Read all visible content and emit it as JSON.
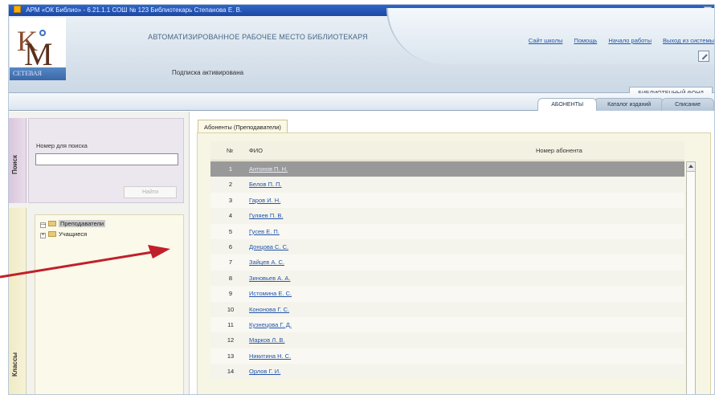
{
  "window": {
    "title": "АРМ «ОК Библио» - 6.21.1.1 СОШ № 123 Библиотекарь Степанова Е. В."
  },
  "logo": {
    "bar_text": "CЕТЕВАЯ"
  },
  "header": {
    "title": "АВТОМАТИЗИРОВАННОЕ РАБОЧЕЕ МЕСТО БИБЛИОТЕКАРЯ",
    "status": "Подписка активирована",
    "links": [
      "Сайт школы",
      "Помощь",
      "Начало работы",
      "Выход из системы"
    ],
    "section_tab": "БИБЛИОТЕЧНЫЙ ФОНД"
  },
  "tabs": [
    {
      "label": "АБОНЕНТЫ",
      "active": true
    },
    {
      "label": "Каталог изданий",
      "active": false
    },
    {
      "label": "Списание",
      "active": false
    }
  ],
  "sidebar": {
    "search_label": "Поиск",
    "catalog_label": "Классы",
    "search_field_label": "Номер для поиска",
    "search_value": "",
    "find_button": "Найти",
    "tree": [
      {
        "toggle": "—",
        "label": "Преподаватели",
        "selected": true
      },
      {
        "toggle": "+",
        "label": "Учащиеся",
        "selected": false
      }
    ]
  },
  "content": {
    "tab_label": "Абоненты (Преподаватели)",
    "columns": {
      "num": "№",
      "fio": "ФИО",
      "card": "Номер абонента"
    },
    "rows": [
      {
        "num": "1",
        "name": "Антонов П. Н.",
        "selected": true
      },
      {
        "num": "2",
        "name": "Белов П. П.",
        "selected": false
      },
      {
        "num": "3",
        "name": "Гаров И. Н.",
        "selected": false
      },
      {
        "num": "4",
        "name": "Гуляев П. В.",
        "selected": false
      },
      {
        "num": "5",
        "name": "Гусев Е. П.",
        "selected": false
      },
      {
        "num": "6",
        "name": "Донцова С. С.",
        "selected": false
      },
      {
        "num": "7",
        "name": "Зайцев А. С.",
        "selected": false
      },
      {
        "num": "8",
        "name": "Зиновьев А. А.",
        "selected": false
      },
      {
        "num": "9",
        "name": "Истомина Е. С.",
        "selected": false
      },
      {
        "num": "10",
        "name": "Кононова Г. С.",
        "selected": false
      },
      {
        "num": "11",
        "name": "Кузнецова Г. Д.",
        "selected": false
      },
      {
        "num": "12",
        "name": "Марков Л. В.",
        "selected": false
      },
      {
        "num": "13",
        "name": "Никитина Н. С.",
        "selected": false
      },
      {
        "num": "14",
        "name": "Орлов Г. И.",
        "selected": false
      }
    ]
  },
  "colors": {
    "arrow": "#c0202a",
    "selected_row": "#999999",
    "link": "#2255aa"
  }
}
